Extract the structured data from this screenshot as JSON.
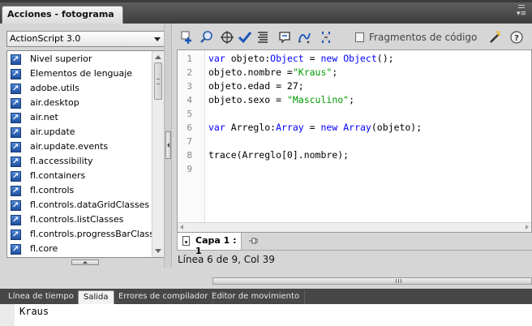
{
  "window": {
    "title": "Acciones - fotograma",
    "panel_menu_glyph": "▾≡"
  },
  "left_pane": {
    "language_select": {
      "value": "ActionScript 3.0"
    },
    "library_items": [
      "Nivel superior",
      "Elementos de lenguaje",
      "adobe.utils",
      "air.desktop",
      "air.net",
      "air.update",
      "air.update.events",
      "fl.accessibility",
      "fl.containers",
      "fl.controls",
      "fl.controls.dataGridClasses",
      "fl.controls.listClasses",
      "fl.controls.progressBarClasses",
      "fl.core"
    ]
  },
  "toolbar": {
    "icons": [
      "add-statement-icon",
      "find-icon",
      "insert-target-path-icon",
      "check-syntax-icon",
      "auto-format-icon",
      "show-code-hint-icon",
      "debug-options-icon",
      "collapse-braces-icon"
    ],
    "snippets_label": "Fragmentos de código",
    "wizard_icon": "magic-wand-icon",
    "help_icon": "help-icon"
  },
  "editor": {
    "line_numbers": [
      "1",
      "2",
      "3",
      "4",
      "5",
      "6",
      "7",
      "8",
      "9"
    ],
    "lines": [
      [
        {
          "t": "var",
          "c": "kw"
        },
        {
          "t": " objeto:",
          "c": ""
        },
        {
          "t": "Object",
          "c": "kw"
        },
        {
          "t": " = ",
          "c": ""
        },
        {
          "t": "new",
          "c": "kw"
        },
        {
          "t": " ",
          "c": ""
        },
        {
          "t": "Object",
          "c": "kw"
        },
        {
          "t": "();",
          "c": ""
        }
      ],
      [
        {
          "t": "objeto.nombre =",
          "c": ""
        },
        {
          "t": "\"Kraus\"",
          "c": "str"
        },
        {
          "t": ";",
          "c": ""
        }
      ],
      [
        {
          "t": "objeto.edad = 27;",
          "c": ""
        }
      ],
      [
        {
          "t": "objeto.sexo = ",
          "c": ""
        },
        {
          "t": "\"Masculino\"",
          "c": "str"
        },
        {
          "t": ";",
          "c": ""
        }
      ],
      [],
      [
        {
          "t": "var",
          "c": "kw"
        },
        {
          "t": " Arreglo:",
          "c": ""
        },
        {
          "t": "Array",
          "c": "kw"
        },
        {
          "t": " = ",
          "c": ""
        },
        {
          "t": "new",
          "c": "kw"
        },
        {
          "t": " ",
          "c": ""
        },
        {
          "t": "Array",
          "c": "kw"
        },
        {
          "t": "(objeto);",
          "c": ""
        }
      ],
      [],
      [
        {
          "t": "trace(Arreglo[0].nombre);",
          "c": ""
        }
      ],
      []
    ],
    "keyword_color": "#0000ff",
    "string_color": "#009900"
  },
  "script_tab": {
    "label": "Capa 1 : 1"
  },
  "status": {
    "text": "Línea 6 de 9, Col 39"
  },
  "bottom_tabs": [
    {
      "label": "Línea de tiempo",
      "active": false
    },
    {
      "label": "Salida",
      "active": true
    },
    {
      "label": "Errores de compilador",
      "active": false
    },
    {
      "label": "Editor de movimiento",
      "active": false
    }
  ],
  "output": {
    "text": "Kraus"
  }
}
